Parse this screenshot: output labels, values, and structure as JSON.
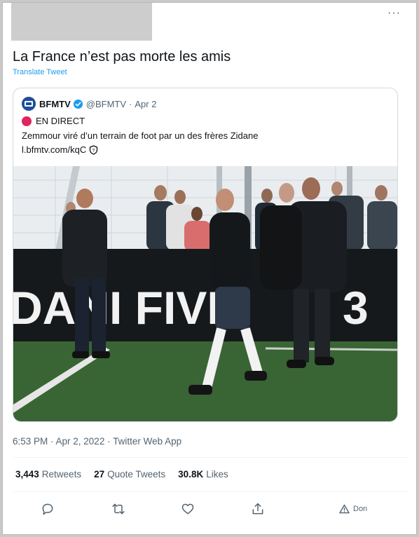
{
  "tweet": {
    "text": "La France n’est pas morte les amis",
    "translate_label": "Translate Tweet",
    "more_label": "···"
  },
  "quote": {
    "name": "BFMTV",
    "handle": "@BFMTV",
    "separator": "·",
    "date": "Apr 2",
    "live_label": "EN DIRECT",
    "text": "Zemmour viré d’un terrain de foot par un des frères Zidane",
    "link": "l.bfmtv.com/kqC",
    "image_banner_text": "DANI FIVE",
    "image_banner_tail": "3"
  },
  "meta": {
    "timestamp": "6:53 PM · Apr 2, 2022 · Twitter Web App"
  },
  "stats": {
    "retweets_count": "3,443",
    "retweets_label": "Retweets",
    "quotes_count": "27",
    "quotes_label": "Quote Tweets",
    "likes_count": "30.8K",
    "likes_label": "Likes"
  },
  "actions": {
    "report_label": "Don"
  },
  "colors": {
    "accent": "#1d9bf0",
    "live": "#e0245e",
    "muted": "#536471"
  }
}
